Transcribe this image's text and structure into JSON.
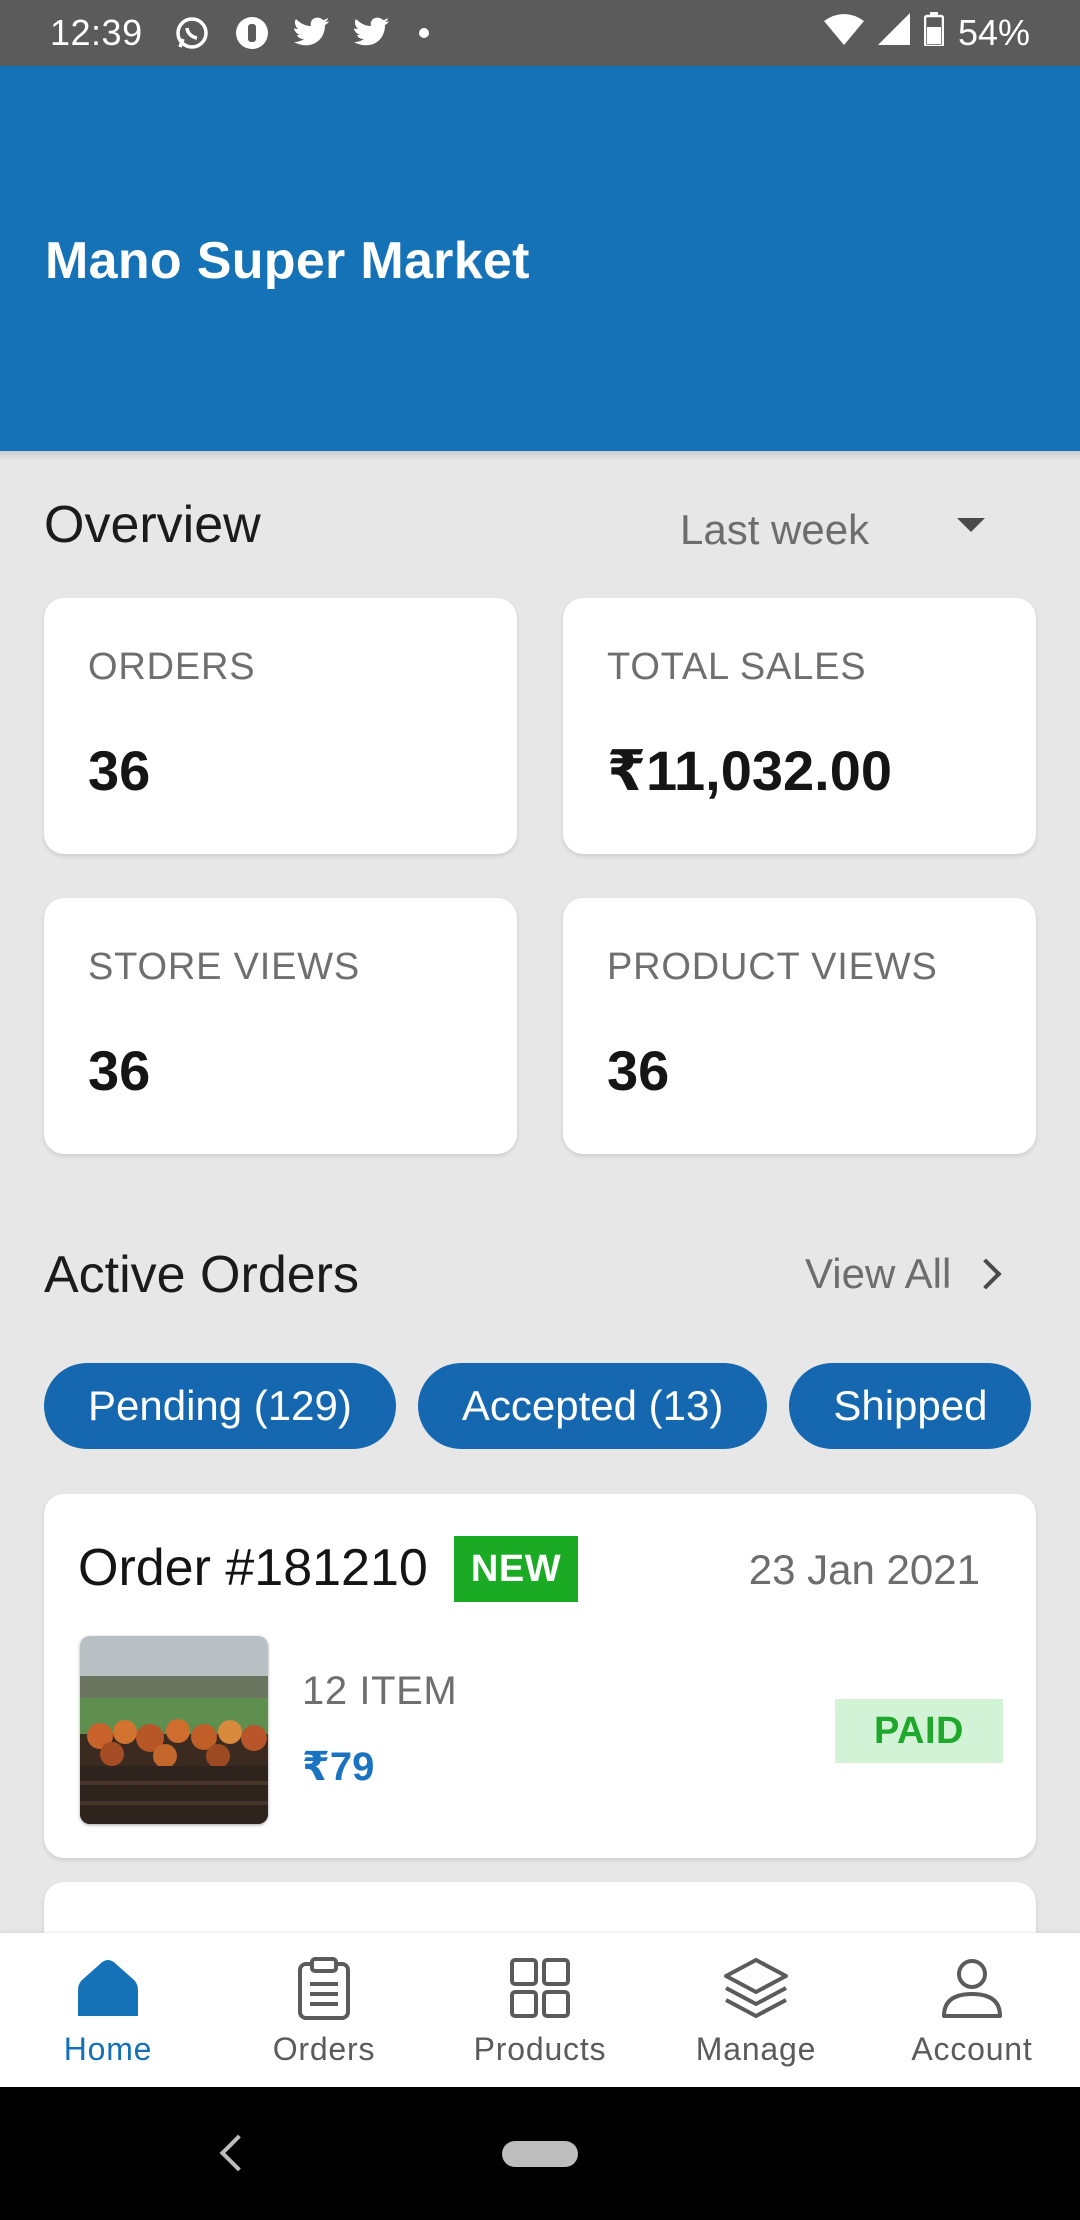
{
  "status_bar": {
    "time": "12:39",
    "notification_icons": [
      "whatsapp-icon",
      "unknown-app-icon",
      "twitter-icon",
      "twitter-icon"
    ],
    "battery": "54%"
  },
  "header": {
    "store_name": "Mano Super Market",
    "color": "#1572b6"
  },
  "overview": {
    "title": "Overview",
    "range": {
      "selected": "Last week"
    },
    "metrics": [
      {
        "label": "ORDERS",
        "value": "36"
      },
      {
        "label": "TOTAL SALES",
        "value": "₹11,032.00"
      },
      {
        "label": "STORE VIEWS",
        "value": "36"
      },
      {
        "label": "PRODUCT VIEWS",
        "value": "36"
      }
    ]
  },
  "active_orders": {
    "title": "Active Orders",
    "view_all": "View All",
    "filters": [
      {
        "label": "Pending (129)"
      },
      {
        "label": "Accepted (13)"
      },
      {
        "label": "Shipped"
      }
    ],
    "orders": [
      {
        "id": "Order #181210",
        "badge": "NEW",
        "date": "23 Jan 2021",
        "items": "12 ITEM",
        "amount": "₹79",
        "payment_status": "PAID"
      }
    ]
  },
  "bottom_nav": {
    "items": [
      {
        "label": "Home",
        "icon": "home-icon",
        "active": true
      },
      {
        "label": "Orders",
        "icon": "clipboard-icon",
        "active": false
      },
      {
        "label": "Products",
        "icon": "grid-icon",
        "active": false
      },
      {
        "label": "Manage",
        "icon": "layers-icon",
        "active": false
      },
      {
        "label": "Account",
        "icon": "person-icon",
        "active": false
      }
    ]
  },
  "colors": {
    "primary": "#1572b6",
    "chip": "#1568b0",
    "new_badge": "#1aaa24",
    "paid_badge_bg": "#d3f3d6",
    "paid_badge_text": "#1fa82b",
    "amount": "#1a73c0"
  }
}
